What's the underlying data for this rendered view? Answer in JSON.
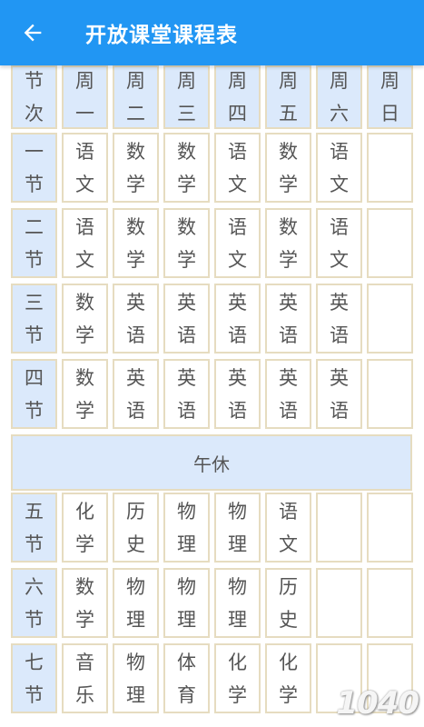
{
  "app_bar": {
    "title": "开放课堂课程表",
    "back_icon": "arrow-left-icon"
  },
  "colors": {
    "app_bar": "#2196F3",
    "label_bg": "#dbe9fb",
    "cell_border": "#e6dcc0",
    "text": "#555555"
  },
  "header": {
    "section_label": [
      "节",
      "次"
    ],
    "days": [
      [
        "周",
        "一"
      ],
      [
        "周",
        "二"
      ],
      [
        "周",
        "三"
      ],
      [
        "周",
        "四"
      ],
      [
        "周",
        "五"
      ],
      [
        "周",
        "六"
      ],
      [
        "周",
        "日"
      ]
    ]
  },
  "periods": [
    {
      "label": [
        "一",
        "节"
      ],
      "classes": [
        [
          "语",
          "文"
        ],
        [
          "数",
          "学"
        ],
        [
          "数",
          "学"
        ],
        [
          "语",
          "文"
        ],
        [
          "数",
          "学"
        ],
        [
          "语",
          "文"
        ],
        []
      ]
    },
    {
      "label": [
        "二",
        "节"
      ],
      "classes": [
        [
          "语",
          "文"
        ],
        [
          "数",
          "学"
        ],
        [
          "数",
          "学"
        ],
        [
          "语",
          "文"
        ],
        [
          "数",
          "学"
        ],
        [
          "语",
          "文"
        ],
        []
      ]
    },
    {
      "label": [
        "三",
        "节"
      ],
      "classes": [
        [
          "数",
          "学"
        ],
        [
          "英",
          "语"
        ],
        [
          "英",
          "语"
        ],
        [
          "英",
          "语"
        ],
        [
          "英",
          "语"
        ],
        [
          "英",
          "语"
        ],
        []
      ]
    },
    {
      "label": [
        "四",
        "节"
      ],
      "classes": [
        [
          "数",
          "学"
        ],
        [
          "英",
          "语"
        ],
        [
          "英",
          "语"
        ],
        [
          "英",
          "语"
        ],
        [
          "英",
          "语"
        ],
        [
          "英",
          "语"
        ],
        []
      ]
    },
    {
      "label": [
        "五",
        "节"
      ],
      "classes": [
        [
          "化",
          "学"
        ],
        [
          "历",
          "史"
        ],
        [
          "物",
          "理"
        ],
        [
          "物",
          "理"
        ],
        [
          "语",
          "文"
        ],
        [],
        []
      ]
    },
    {
      "label": [
        "六",
        "节"
      ],
      "classes": [
        [
          "数",
          "学"
        ],
        [
          "物",
          "理"
        ],
        [
          "物",
          "理"
        ],
        [
          "物",
          "理"
        ],
        [
          "历",
          "史"
        ],
        [],
        []
      ]
    },
    {
      "label": [
        "七",
        "节"
      ],
      "classes": [
        [
          "音",
          "乐"
        ],
        [
          "物",
          "理"
        ],
        [
          "体",
          "育"
        ],
        [
          "化",
          "学"
        ],
        [
          "化",
          "学"
        ],
        [],
        []
      ]
    }
  ],
  "lunch": "午休",
  "watermark": "1040"
}
